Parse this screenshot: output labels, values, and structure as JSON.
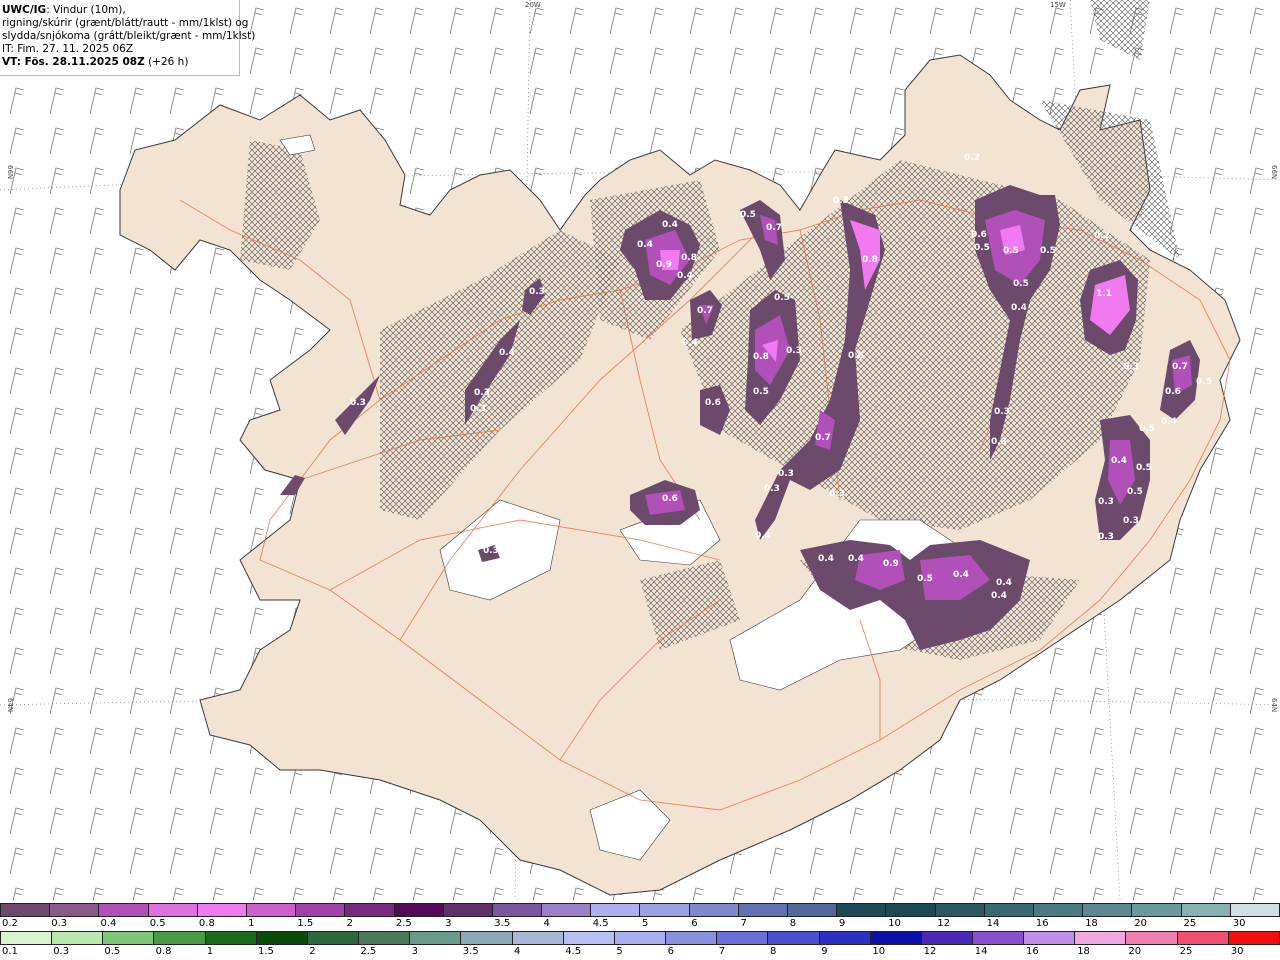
{
  "header": {
    "model": "UWC/IG",
    "line1_rest": ": Vindur (10m),",
    "line2": "rigning/skúrir (grænt/blátt/rautt - mm/1klst) og",
    "line3": "slydda/snjókoma (grátt/bleikt/grænt - mm/1klst)",
    "init_time": "IT: Fim. 27. 11. 2025 06Z",
    "valid_prefix": "VT: Fös. 28.11.2025 08Z",
    "valid_suffix": " (+26 h)"
  },
  "coords": {
    "lon20": "20W",
    "lon15": "15W",
    "lat66_left": "66N",
    "lat66_right": "66N",
    "lat64_left": "64N",
    "lat64_right": "64N"
  },
  "colors": {
    "land": "#f2e3d3",
    "coast": "#3a3a3a",
    "roads": "#e8734a",
    "snow_light": "#6b4a6b",
    "snow_mid": "#b050b8",
    "snow_heavy": "#f07af0"
  },
  "precip_labels": [
    {
      "v": "0.4"
    },
    {
      "v": "0.4"
    },
    {
      "v": "0.9"
    },
    {
      "v": "0.8"
    },
    {
      "v": "0.4"
    },
    {
      "v": "0.5"
    },
    {
      "v": "0.7"
    },
    {
      "v": "0.3"
    },
    {
      "v": "0.8"
    },
    {
      "v": "0.5"
    },
    {
      "v": "0.7"
    },
    {
      "v": "0.4"
    },
    {
      "v": "0.8"
    },
    {
      "v": "0.3"
    },
    {
      "v": "0.5"
    },
    {
      "v": "0.6"
    },
    {
      "v": "0.6"
    },
    {
      "v": "0.7"
    },
    {
      "v": "0.3"
    },
    {
      "v": "0.3"
    },
    {
      "v": "0.3"
    },
    {
      "v": "0.6"
    },
    {
      "v": "0.4"
    },
    {
      "v": "0.4"
    },
    {
      "v": "0.4"
    },
    {
      "v": "0.9"
    },
    {
      "v": "0.5"
    },
    {
      "v": "0.4"
    },
    {
      "v": "0.4"
    },
    {
      "v": "0.4"
    },
    {
      "v": "0.6"
    },
    {
      "v": "0.5"
    },
    {
      "v": "0.5"
    },
    {
      "v": "0.5"
    },
    {
      "v": "0.5"
    },
    {
      "v": "0.4"
    },
    {
      "v": "0.3"
    },
    {
      "v": "0.3"
    },
    {
      "v": "1.1"
    },
    {
      "v": "0.3"
    },
    {
      "v": "0.7"
    },
    {
      "v": "0.6"
    },
    {
      "v": "0.4"
    },
    {
      "v": "0.5"
    },
    {
      "v": "0.4"
    },
    {
      "v": "0.5"
    },
    {
      "v": "0.5"
    },
    {
      "v": "0.3"
    },
    {
      "v": "0.3"
    },
    {
      "v": "0.3"
    },
    {
      "v": "0.3"
    },
    {
      "v": "0.3"
    },
    {
      "v": "0.4"
    },
    {
      "v": "0.3"
    },
    {
      "v": "0.5"
    },
    {
      "v": "0.3"
    },
    {
      "v": "0.3"
    },
    {
      "v": "0.2"
    },
    {
      "v": "0.2"
    }
  ],
  "legend": {
    "row1": {
      "labels": [
        "0.2",
        "0.3",
        "0.4",
        "0.5",
        "0.8",
        "1",
        "1.5",
        "2",
        "2.5",
        "3",
        "3.5",
        "4",
        "4.5",
        "5",
        "6",
        "7",
        "8",
        "9",
        "10",
        "12",
        "14",
        "16",
        "18",
        "20",
        "25",
        "30"
      ],
      "colors": [
        "#6b4a6b",
        "#8a5a8a",
        "#b050b8",
        "#e070e0",
        "#f07af0",
        "#d060d0",
        "#a040a8",
        "#7a2880",
        "#500a58",
        "#60306a",
        "#7a58a0",
        "#9a80c8",
        "#b0b0f0",
        "#9aa0e0",
        "#8088d0",
        "#6070b0",
        "#50689a",
        "#1e4a58",
        "#184a50",
        "#2a5a60",
        "#3a6a70",
        "#4a7a80",
        "#5a8a90",
        "#6a9a9a",
        "#88b0b0",
        "#d0e0e0"
      ]
    },
    "row2": {
      "labels": [
        "0.1",
        "0.3",
        "0.5",
        "0.8",
        "1",
        "1.5",
        "2",
        "2.5",
        "3",
        "3.5",
        "4",
        "4.5",
        "5",
        "6",
        "7",
        "8",
        "9",
        "10",
        "12",
        "14",
        "16",
        "18",
        "20",
        "25",
        "30"
      ],
      "colors": [
        "#d8f5d0",
        "#b8e8b0",
        "#80c878",
        "#4a9a44",
        "#1a6a18",
        "#0a4a0a",
        "#2a6a3a",
        "#4a7a5a",
        "#6a9a8a",
        "#8aa8b8",
        "#a8b8d8",
        "#b8c0f0",
        "#a8b0f0",
        "#8890e0",
        "#6a70d8",
        "#4a50d0",
        "#2a30c0",
        "#0a10a8",
        "#4a28b8",
        "#8a50d0",
        "#c090e8",
        "#f0a8e0",
        "#f080b0",
        "#f05070",
        "#f01010"
      ]
    }
  }
}
